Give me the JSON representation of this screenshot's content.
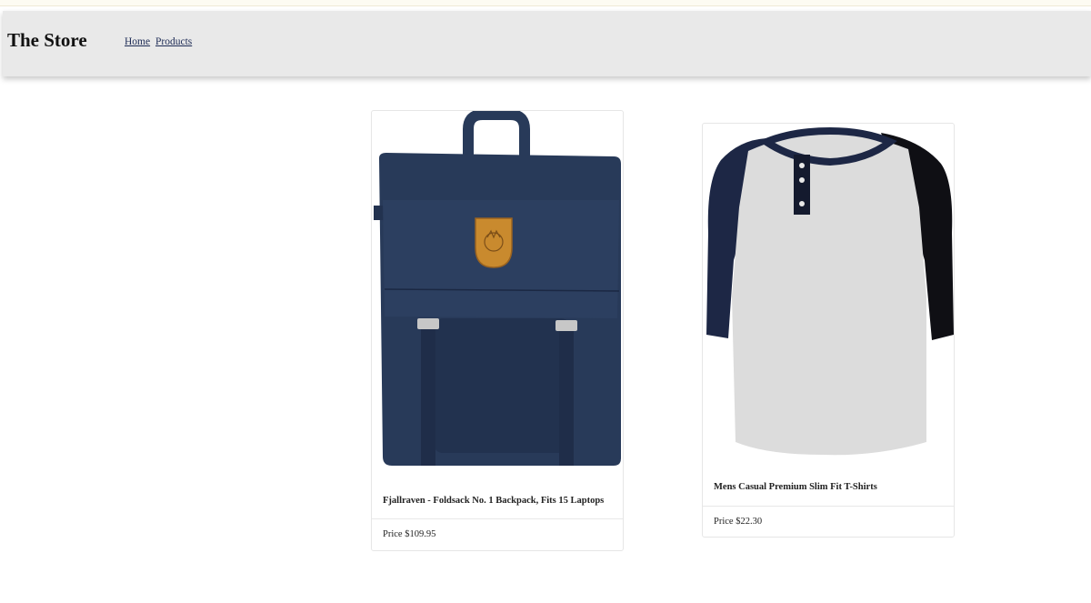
{
  "header": {
    "brand": "The Store",
    "nav": [
      {
        "label": "Home"
      },
      {
        "label": "Products"
      }
    ]
  },
  "products": [
    {
      "title": "Fjallraven - Foldsack No. 1 Backpack, Fits 15 Laptops",
      "price": "Price $109.95",
      "image": "navy-backpack-image"
    },
    {
      "title": "Mens Casual Premium Slim Fit T-Shirts",
      "price": "Price $22.30",
      "image": "raglan-henley-shirt-image"
    }
  ],
  "colors": {
    "navbar_bg": "#e9e9e9",
    "backpack_navy": "#283a59",
    "backpack_patch": "#c98a2e",
    "shirt_body": "#dcdcdc",
    "shirt_sleeve": "#0f0f14",
    "shirt_trim": "#1d2745"
  }
}
